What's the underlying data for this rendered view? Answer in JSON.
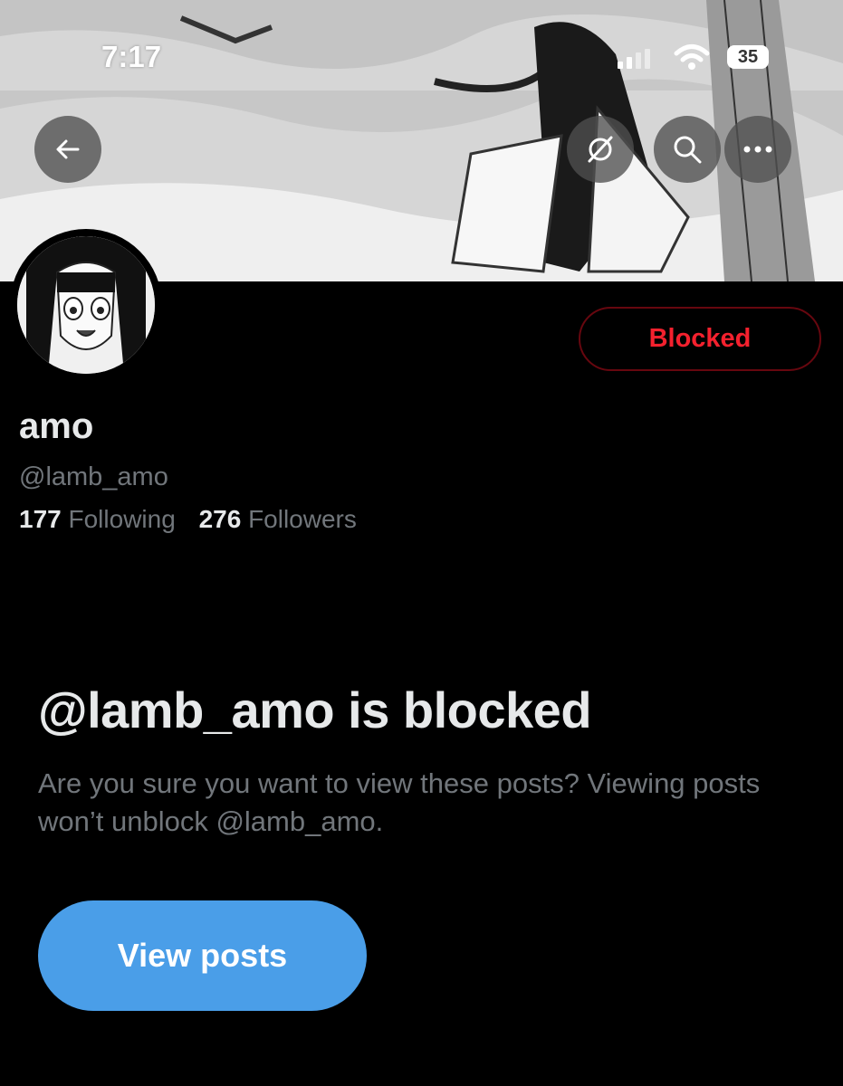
{
  "status_bar": {
    "time": "7:17",
    "battery": "35"
  },
  "header": {
    "icons": {
      "back": "arrow-left-icon",
      "grok": "grok-icon",
      "search": "search-icon",
      "more": "more-horizontal-icon"
    }
  },
  "profile": {
    "display_name": "amo",
    "handle": "@lamb_amo",
    "following_count": "177",
    "following_label": "Following",
    "followers_count": "276",
    "followers_label": "Followers",
    "blocked_button_label": "Blocked"
  },
  "blocked_notice": {
    "title": "@lamb_amo is blocked",
    "description": "Are you sure you want to view these posts? Viewing posts won’t unblock @lamb_amo.",
    "view_posts_label": "View posts"
  },
  "colors": {
    "background": "#000000",
    "text_primary": "#e7e9ea",
    "text_secondary": "#71767b",
    "blocked_red": "#f4212e",
    "view_posts_blue": "#4a9ee8"
  }
}
